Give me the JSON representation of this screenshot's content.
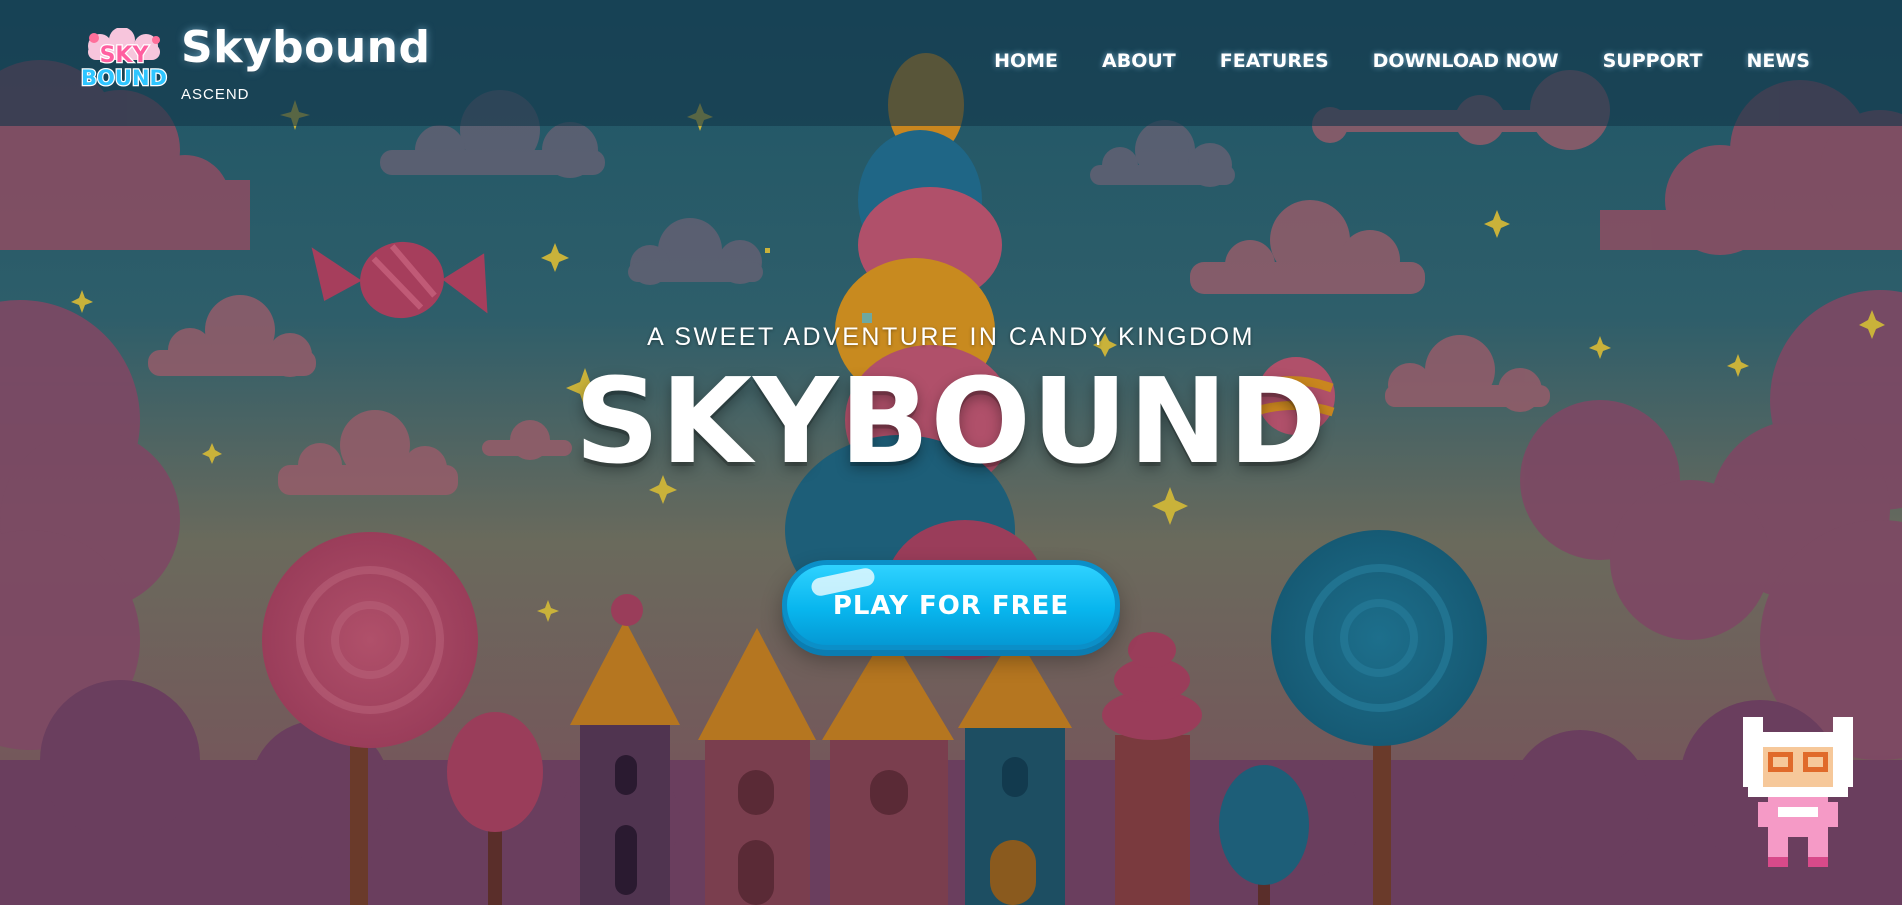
{
  "brand": {
    "logo_text_top": "SKY",
    "logo_text_bottom": "BOUND",
    "name": "Skybound",
    "tagline": "ASCEND"
  },
  "nav": {
    "items": [
      {
        "label": "HOME"
      },
      {
        "label": "ABOUT"
      },
      {
        "label": "FEATURES"
      },
      {
        "label": "DOWNLOAD NOW"
      },
      {
        "label": "SUPPORT"
      },
      {
        "label": "NEWS"
      }
    ]
  },
  "hero": {
    "subtitle": "A SWEET ADVENTURE IN CANDY KINGDOM",
    "title": "SKYBOUND",
    "cta_label": "PLAY FOR FREE"
  },
  "colors": {
    "header_bg": "#1e4a5e",
    "sky_top": "#1d5566",
    "sky_bottom": "#8a5a4e",
    "cta": "#08b6ee",
    "text": "#ffffff",
    "star": "#c9b23a"
  },
  "icons": {
    "logo": "skybound-logo-icon",
    "mascot": "pixel-astronaut-mascot-icon"
  }
}
